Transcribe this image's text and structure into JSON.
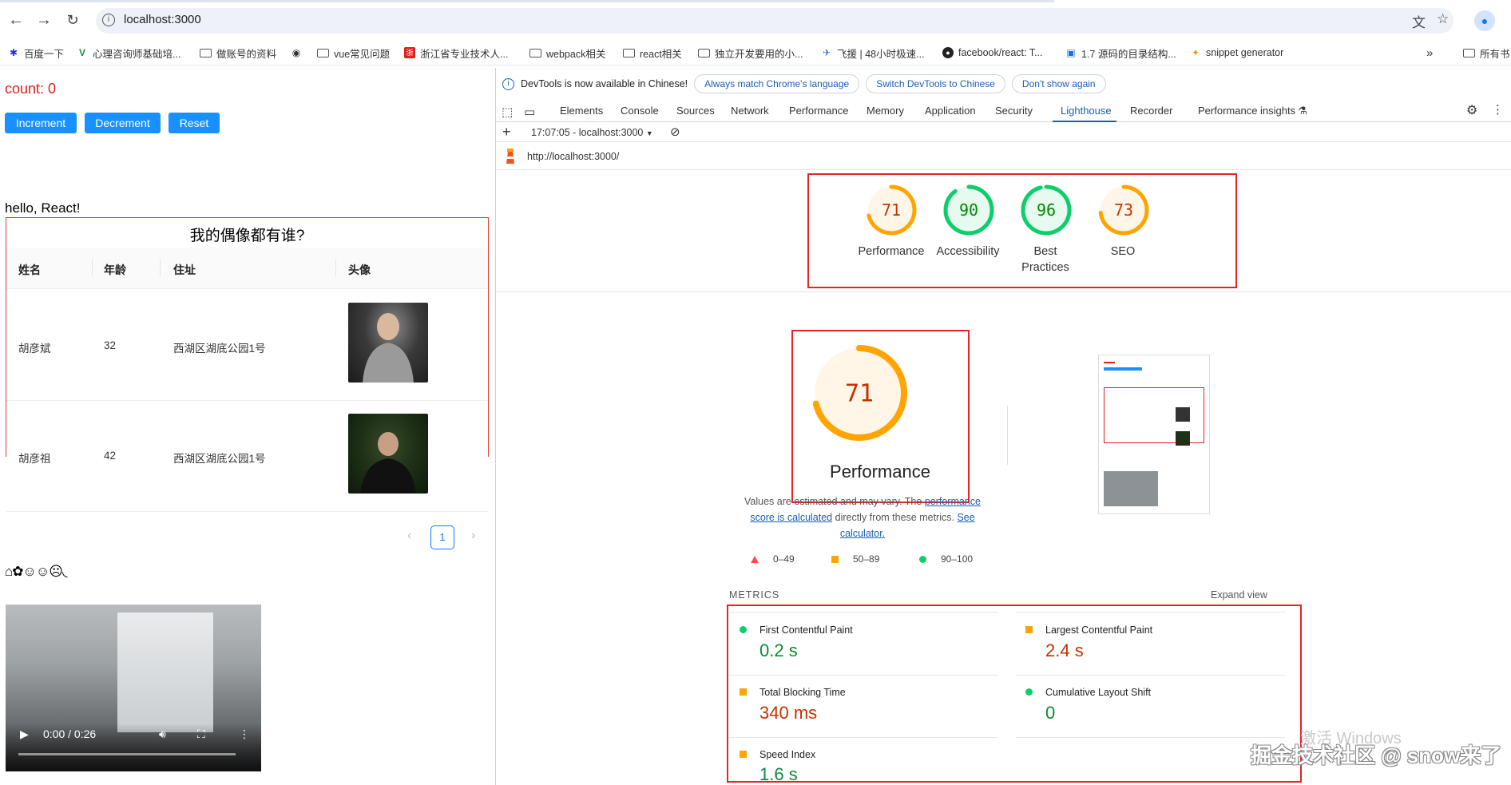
{
  "browser": {
    "url": "localhost:3000",
    "bookmarks": [
      "百度一下",
      "心理咨询师基础培...",
      "做账号的资料",
      "",
      "vue常见问题",
      "浙江省专业技术人...",
      "webpack相关",
      "react相关",
      "独立开发要用的小...",
      "飞援 | 48小时极速...",
      "facebook/react: T...",
      "1.7 源码的目录结构...",
      "snippet generator"
    ],
    "bookmarks_more": "»",
    "bookmarks_all": "所有书"
  },
  "app": {
    "count_text": "count: 0",
    "buttons": [
      "Increment",
      "Decrement",
      "Reset"
    ],
    "hello": "hello, React!",
    "table": {
      "title": "我的偶像都有谁?",
      "columns": [
        "姓名",
        "年龄",
        "住址",
        "头像"
      ],
      "rows": [
        {
          "name": "胡彦斌",
          "age": "32",
          "address": "西湖区湖底公园1号"
        },
        {
          "name": "胡彦祖",
          "age": "42",
          "address": "西湖区湖底公园1号"
        }
      ]
    },
    "pager": {
      "current": "1",
      "prev": "‹",
      "next": "›"
    },
    "emoji_row": "⌂✿☺☺☹◟",
    "video": {
      "time": "0:00 / 0:26"
    }
  },
  "devtools": {
    "notice": "DevTools is now available in Chinese!",
    "notice_buttons": [
      "Always match Chrome's language",
      "Switch DevTools to Chinese",
      "Don't show again"
    ],
    "tabs": [
      "Elements",
      "Console",
      "Sources",
      "Network",
      "Performance",
      "Memory",
      "Application",
      "Security",
      "Lighthouse",
      "Recorder",
      "Performance insights"
    ],
    "active_tab": "Lighthouse",
    "report_select": "17:07:05 - localhost:3000",
    "report_url": "http://localhost:3000/",
    "scores": [
      {
        "label": "Performance",
        "score": 71,
        "color": "#ffa400"
      },
      {
        "label": "Accessibility",
        "score": 90,
        "color": "#0cce6b"
      },
      {
        "label": "Best Practices",
        "score": 96,
        "color": "#0cce6b"
      },
      {
        "label": "SEO",
        "score": 73,
        "color": "#ffa400"
      }
    ],
    "main_score": {
      "label": "Performance",
      "score": 71
    },
    "values_pre": "Values are estimated and may vary. The ",
    "values_link1": "performance score is calculated",
    "values_mid": " directly from these metrics. ",
    "values_link2": "See calculator.",
    "legend": [
      "0–49",
      "50–89",
      "90–100"
    ],
    "metrics_title": "METRICS",
    "expand": "Expand view",
    "metrics": [
      {
        "label": "First Contentful Paint",
        "value": "0.2 s",
        "status": "good"
      },
      {
        "label": "Largest Contentful Paint",
        "value": "2.4 s",
        "status": "average"
      },
      {
        "label": "Total Blocking Time",
        "value": "340 ms",
        "status": "average"
      },
      {
        "label": "Cumulative Layout Shift",
        "value": "0",
        "status": "good"
      },
      {
        "label": "Speed Index",
        "value": "1.6 s",
        "status": "good"
      }
    ]
  },
  "overlay": {
    "activate_windows": "激活 Windows",
    "watermark": "掘金技术社区 @ snow来了"
  },
  "colors": {
    "accent": "#1890ff",
    "red_box": "#e3242b",
    "good": "#0cce6b",
    "average": "#ffa400"
  }
}
